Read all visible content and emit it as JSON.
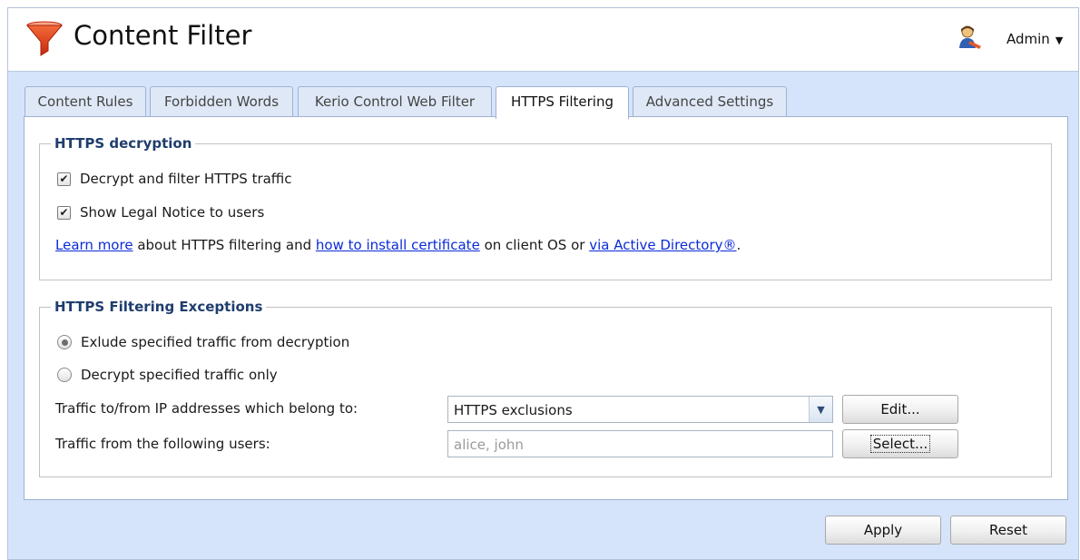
{
  "header": {
    "title": "Content Filter",
    "logo_icon": "funnel-icon",
    "user_icon": "user-icon",
    "user_label": "Admin",
    "user_caret": "▼"
  },
  "tabs": [
    {
      "label": "Content Rules",
      "active": false
    },
    {
      "label": "Forbidden Words",
      "active": false
    },
    {
      "label": "Kerio Control Web Filter",
      "active": false
    },
    {
      "label": "HTTPS Filtering",
      "active": true
    },
    {
      "label": "Advanced Settings",
      "active": false
    }
  ],
  "decryption": {
    "legend": "HTTPS decryption",
    "decrypt_label": "Decrypt and filter HTTPS traffic",
    "decrypt_checked": true,
    "legal_label": "Show Legal Notice to users",
    "legal_checked": true,
    "info": {
      "link1": "Learn more",
      "text1": " about HTTPS filtering and ",
      "link2": "how to install certificate",
      "text2": " on client OS or ",
      "link3": "via Active Directory®",
      "text3": "."
    }
  },
  "exceptions": {
    "legend": "HTTPS Filtering Exceptions",
    "radio_exclude": "Exlude specified traffic from decryption",
    "radio_decrypt": "Decrypt specified traffic only",
    "selected_radio": "exclude",
    "ip_label": "Traffic to/from IP addresses which belong to:",
    "ip_group_value": "HTTPS exclusions",
    "edit_button": "Edit...",
    "users_label": "Traffic from the following users:",
    "users_placeholder": "alice, john",
    "select_button": "Select..."
  },
  "footer": {
    "apply_button": "Apply",
    "reset_button": "Reset"
  },
  "colors": {
    "background": "#d6e4fb",
    "legend": "#1f3d6e",
    "link": "#0a2bd8",
    "logo": "#e8431b"
  }
}
